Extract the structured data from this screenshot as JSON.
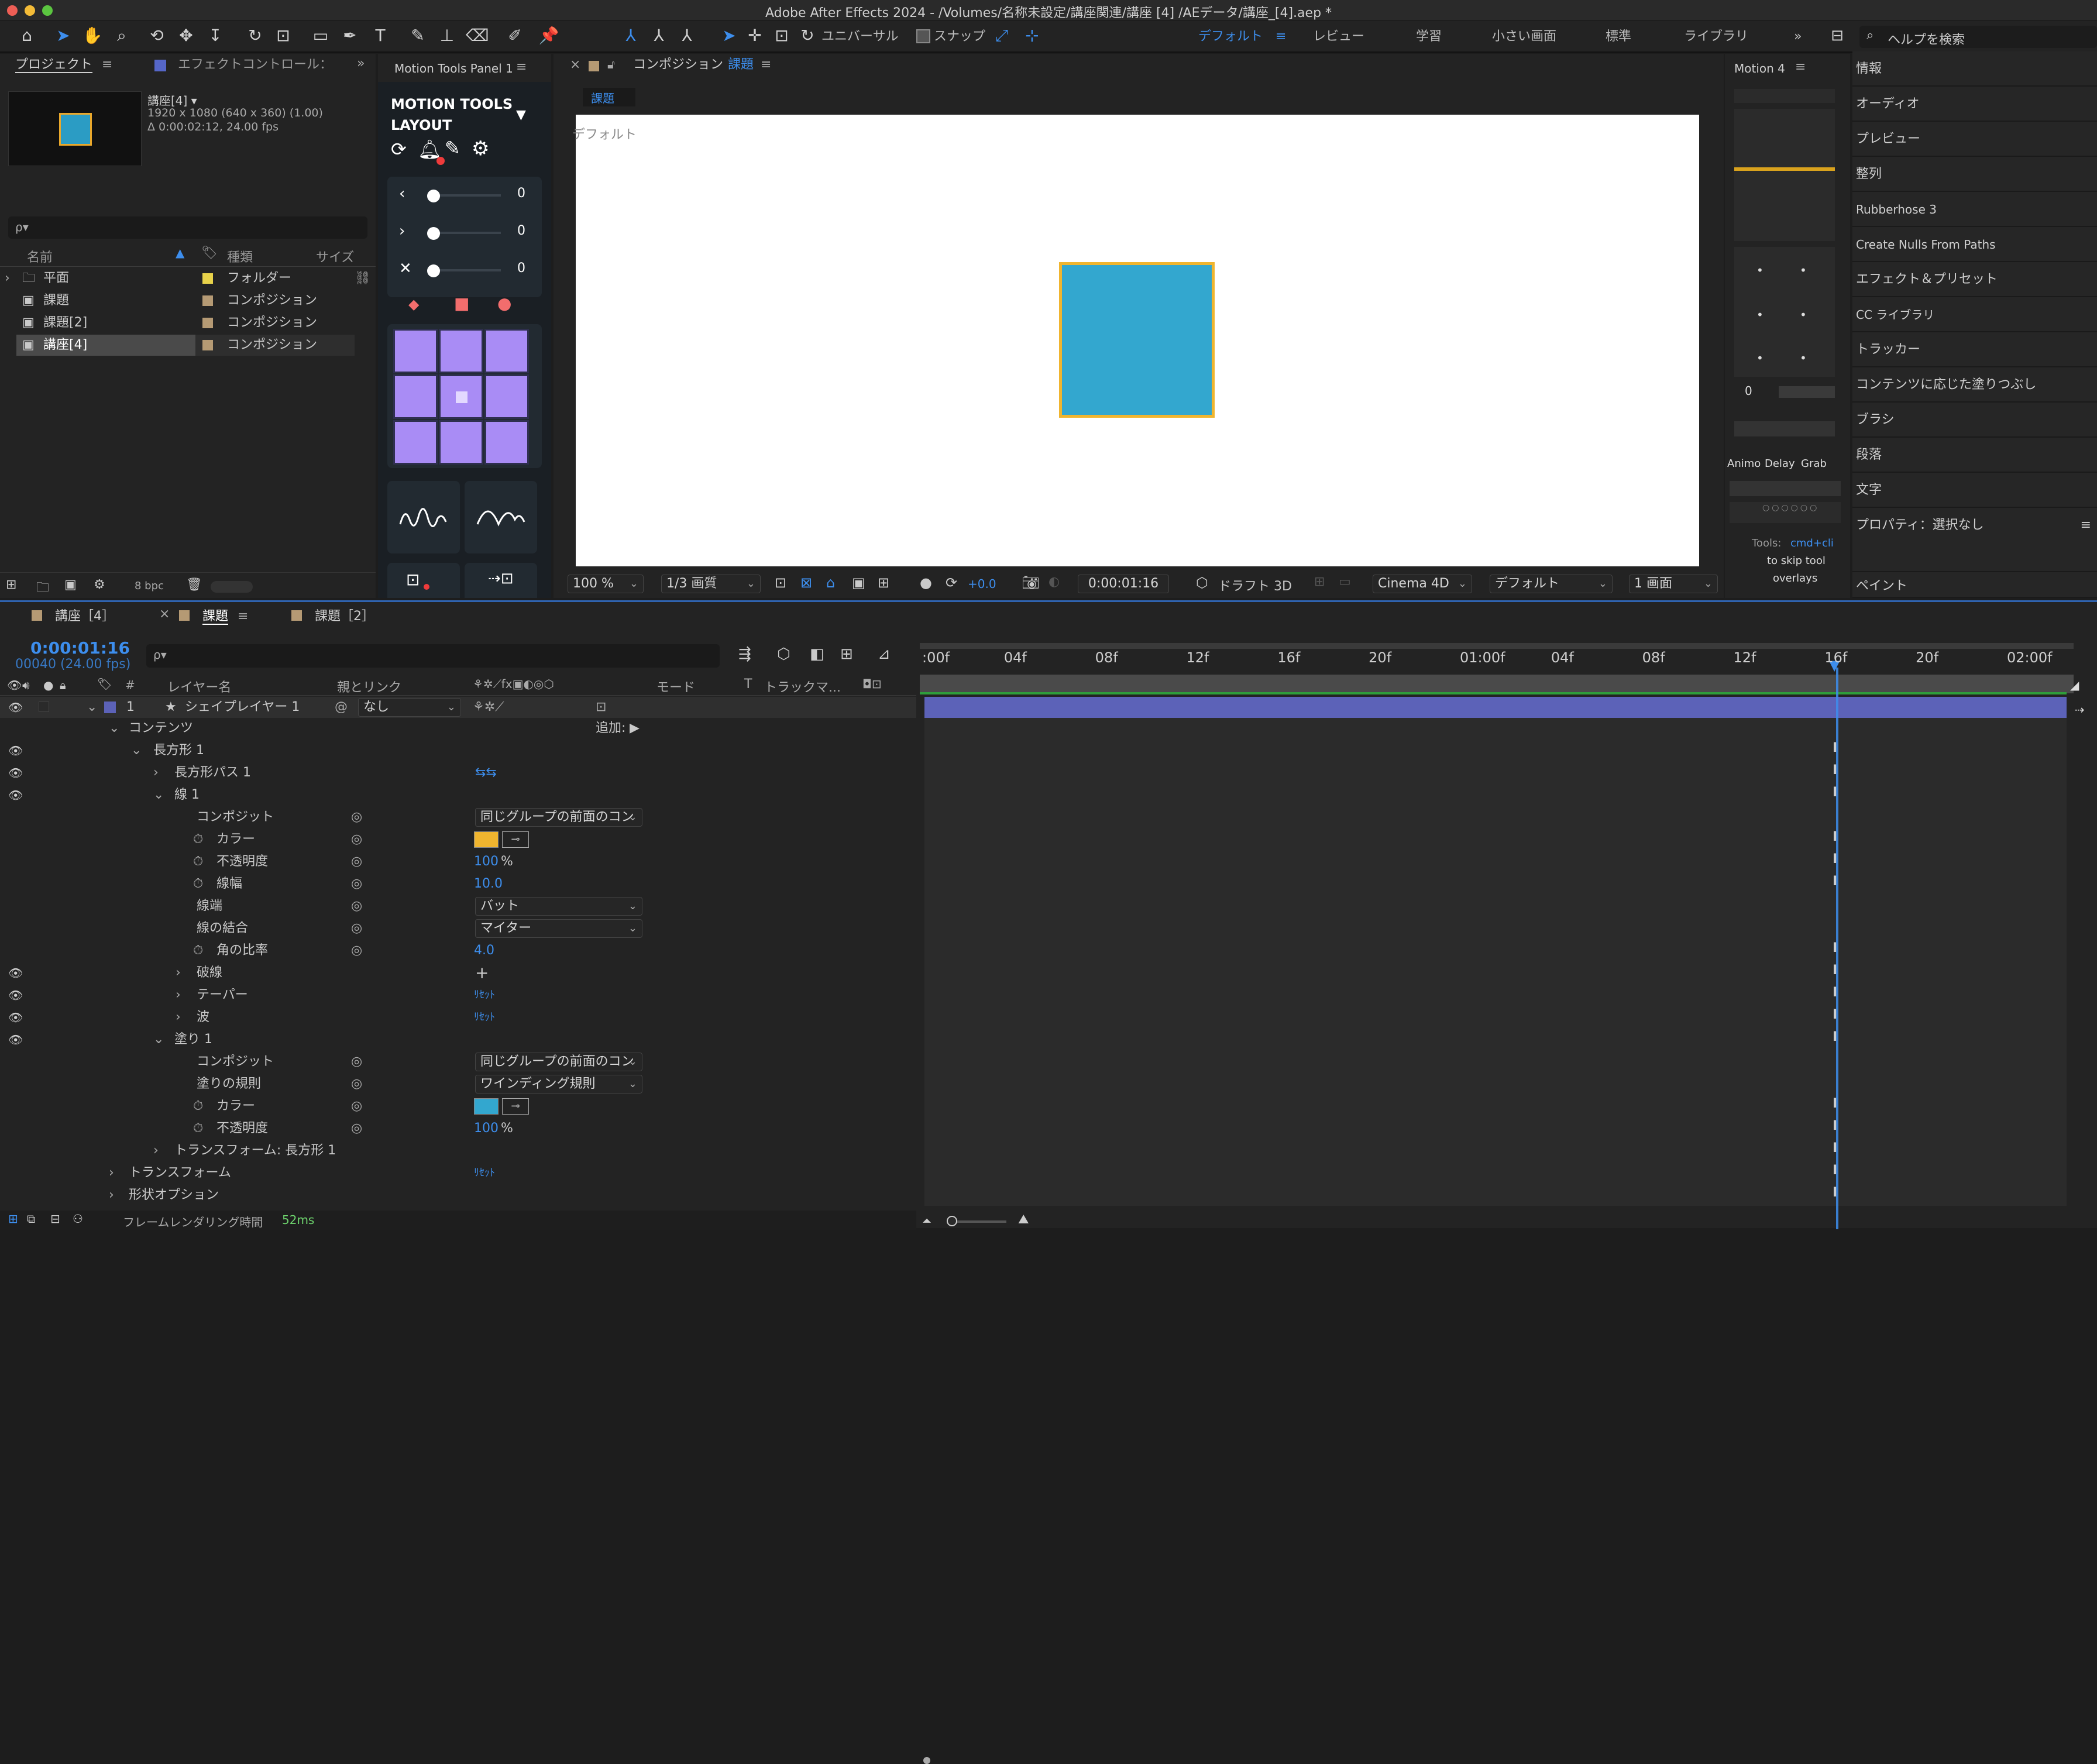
{
  "window": {
    "title": "Adobe After Effects 2024 - /Volumes/名称未設定/講座関連/講座 [4] /AEデータ/講座_[4].aep *"
  },
  "toolbar": {
    "universal_label": "ユニバーサル",
    "snap_label": "スナップ",
    "workspaces": [
      "デフォルト",
      "レビュー",
      "学習",
      "小さい画面",
      "標準",
      "ライブラリ"
    ],
    "help_placeholder": "ヘルプを検索"
  },
  "project": {
    "tab": "プロジェクト",
    "effect_tab": "エフェクトコントロール：",
    "comp_name": "講座[4] ▾",
    "comp_res": "1920 x 1080  (640 x 360) (1.00)",
    "comp_dur": "Δ 0:00:02:12, 24.00 fps",
    "search_placeholder": "ρ▾",
    "cols": {
      "name": "名前",
      "type": "種類",
      "size": "サイズ"
    },
    "items": [
      {
        "name": "平面",
        "type": "フォルダー",
        "color": "#e8d24a"
      },
      {
        "name": "課題",
        "type": "コンポジション",
        "color": "#b59a74"
      },
      {
        "name": "課題[2]",
        "type": "コンポジション",
        "color": "#b59a74"
      },
      {
        "name": "講座[4]",
        "type": "コンポジション",
        "color": "#b59a74"
      }
    ],
    "bpc": "8 bpc"
  },
  "motion_tools": {
    "tab": "Motion Tools Panel 1",
    "title": "MOTION TOOLS",
    "subtitle": "LAYOUT",
    "slider_values": [
      "0",
      "0",
      "0"
    ]
  },
  "composition": {
    "tab_prefix": "コンポジション",
    "tab_name": "課題",
    "subtab": "課題",
    "view_label": "デフォルト",
    "square_color": "#33a7cf",
    "stroke_color": "#f0b52f",
    "footer": {
      "zoom": "100 %",
      "resolution": "1/3 画質",
      "exposure": "+0.0",
      "timecode": "0:00:01:16",
      "draft": "ドラフト 3D",
      "renderer": "Cinema 4D",
      "view": "デフォルト",
      "views": "1 画面"
    }
  },
  "motion4": {
    "tab": "Motion 4",
    "value": "0",
    "labels": [
      "Animo",
      "Delay",
      "Grab"
    ],
    "hint1": "Tools:",
    "hint_key": "cmd+cli",
    "hint2": "to skip tool",
    "hint3": "overlays"
  },
  "sidebar": {
    "items": [
      "情報",
      "オーディオ",
      "プレビュー",
      "整列",
      "Rubberhose 3",
      "Create Nulls From Paths",
      "エフェクト＆プリセット",
      "CC ライブラリ",
      "トラッカー",
      "コンテンツに応じた塗りつぶし",
      "ブラシ",
      "段落",
      "文字"
    ],
    "properties": "プロパティ：選択なし",
    "paint": "ペイント"
  },
  "timeline": {
    "tabs": [
      "講座［4］",
      "課題",
      "課題［2］"
    ],
    "timecode": "0:00:01:16",
    "frames": "00040 (24.00 fps)",
    "search_placeholder": "ρ▾",
    "cols": {
      "layer_name": "レイヤー名",
      "parent": "親とリンク",
      "mode": "モード",
      "t": "T",
      "track": "トラックマ..."
    },
    "layer": {
      "num": "1",
      "name": "シェイプレイヤー 1",
      "parent": "なし"
    },
    "add_label": "追加:",
    "props": {
      "contents": "コンテンツ",
      "rect": "長方形 1",
      "rect_path": "長方形パス 1",
      "stroke": "線 1",
      "composite": "コンポジット",
      "composite_val": "同じグループの前面のコン",
      "color": "カラー",
      "opacity": "不透明度",
      "opacity_val": "100",
      "pct": "%",
      "width": "線幅",
      "width_val": "10.0",
      "cap": "線端",
      "cap_val": "バット",
      "join": "線の結合",
      "join_val": "マイター",
      "miter": "角の比率",
      "miter_val": "4.0",
      "dash": "破線",
      "taper": "テーパー",
      "wave": "波",
      "reset": "ﾘｾｯﾄ",
      "fill": "塗り 1",
      "fill_rule": "塗りの規則",
      "fill_rule_val": "ワインディング規則",
      "fill_composite_val": "同じグループの前面のコン",
      "fill_opacity_val": "100",
      "transform_rect": "トランスフォーム: 長方形 1",
      "transform": "トランスフォーム",
      "shape_opts": "形状オプション"
    },
    "ruler": [
      ":00f",
      "04f",
      "08f",
      "12f",
      "16f",
      "20f",
      "01:00f",
      "04f",
      "08f",
      "12f",
      "16f",
      "20f",
      "02:00f"
    ],
    "render_label": "フレームレンダリング時間",
    "render_val": "52ms",
    "colors": {
      "layer_bar": "#5c62b8",
      "playhead": "#3d8eed",
      "stroke_swatch": "#f0b52f",
      "fill_swatch": "#33a7cf"
    }
  }
}
